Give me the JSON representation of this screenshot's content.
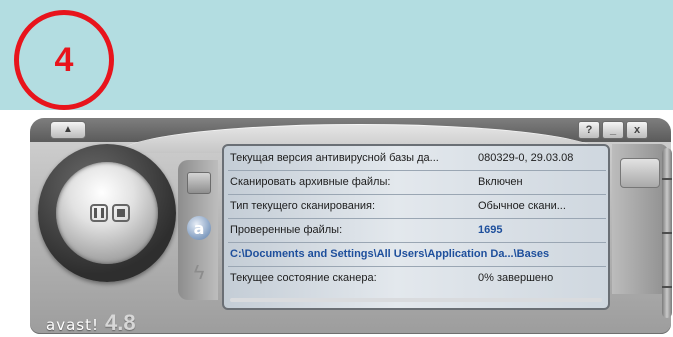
{
  "annotation": {
    "step_number": "4",
    "circle_color": "#e8141c"
  },
  "window": {
    "eject_glyph": "▲",
    "help_label": "?",
    "minimize_label": "_",
    "close_label": "x"
  },
  "brand": {
    "name": "avast!",
    "version": "4.8"
  },
  "side_icons": [
    "chest-icon",
    "avast-logo-icon",
    "lightning-icon"
  ],
  "side_icon_glyphs": {
    "avast": "a",
    "bolt": "ϟ"
  },
  "status_rows": [
    {
      "label": "Текущая версия антивирусной базы да...",
      "value": "080329-0, 29.03.08"
    },
    {
      "label": "Сканировать архивные файлы:",
      "value": "Включен"
    },
    {
      "label": "Тип текущего сканирования:",
      "value": "Обычное скани..."
    },
    {
      "label": "Проверенные файлы:",
      "value": "1695"
    }
  ],
  "current_path": "C:\\Documents and Settings\\All Users\\Application Da...\\Bases",
  "scanner_state": {
    "label": "Текущее состояние сканера:",
    "value": "0% завершено"
  },
  "progress_fraction": 0.0,
  "colors": {
    "accent_value": "#1e4f9c",
    "progress": "#e89a3a"
  }
}
